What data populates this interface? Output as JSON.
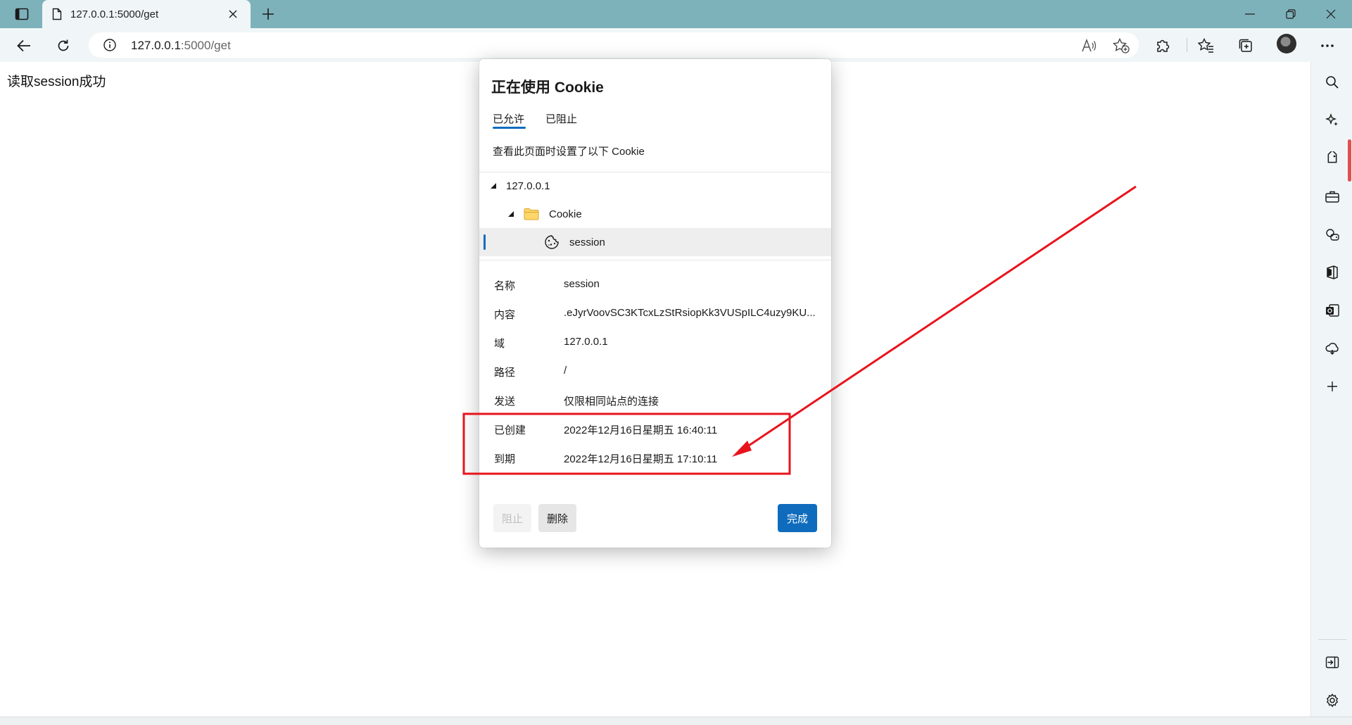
{
  "browser": {
    "tab": {
      "title": "127.0.0.1:5000/get"
    },
    "address": {
      "host": "127.0.0.1",
      "path": ":5000/get"
    }
  },
  "page": {
    "body_text": "读取session成功"
  },
  "cookie_dialog": {
    "title": "正在使用 Cookie",
    "tabs": {
      "allowed": "已允许",
      "blocked": "已阻止"
    },
    "description": "查看此页面时设置了以下 Cookie",
    "tree": {
      "site": "127.0.0.1",
      "folder": "Cookie",
      "cookie": "session"
    },
    "properties": [
      {
        "label": "名称",
        "value": "session"
      },
      {
        "label": "内容",
        "value": ".eJyrVoovSC3KTcxLzStRsiopKk3VUSpILC4uzy9KU..."
      },
      {
        "label": "域",
        "value": "127.0.0.1"
      },
      {
        "label": "路径",
        "value": "/"
      },
      {
        "label": "发送",
        "value": "仅限相同站点的连接"
      },
      {
        "label": "已创建",
        "value": "2022年12月16日星期五 16:40:11"
      },
      {
        "label": "到期",
        "value": "2022年12月16日星期五 17:10:11"
      }
    ],
    "buttons": {
      "block": "阻止",
      "delete": "删除",
      "done": "完成"
    }
  },
  "colors": {
    "tabstrip": "#7eb2bb",
    "toolbar": "#f0f6f7",
    "accent": "#0f6cbd",
    "annotation": "#e8141c"
  }
}
